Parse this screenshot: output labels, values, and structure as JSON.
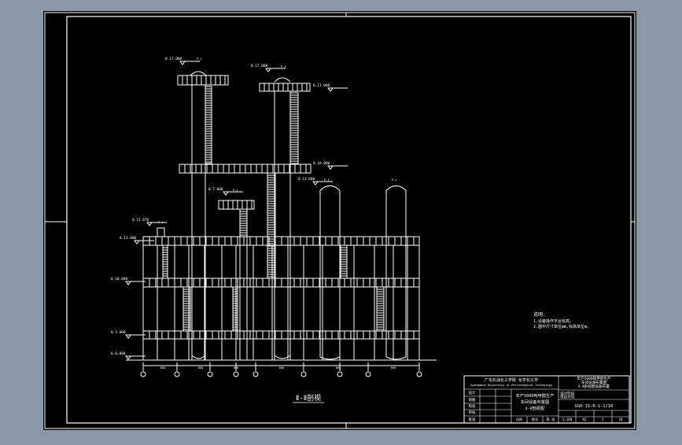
{
  "theme": {
    "background": "#8c98a7",
    "sheet": "#000000",
    "lines": "#ffffff"
  },
  "drawing": {
    "section_title": "Ⅱ-Ⅱ剖视",
    "notes_title": "说明:",
    "notes": [
      "1.设备操作平台标高。",
      "2.图中尺寸单位mm,标高单位m。"
    ],
    "elevations": {
      "left_top": "0.17.000",
      "mid_top": "0.17.000",
      "right_small": "0.11.000",
      "mid_level": "0.10.000",
      "small_top": "0.7.000",
      "vessel_a": "0.13.000",
      "vessel_b": "0.13.000",
      "left_stub": "0.13.070",
      "frame_top": "0.13.000",
      "frame_mid": "0.10.000",
      "frame_low": "0.3.000",
      "ground": "0.0.000"
    },
    "tag": "P-1",
    "dims": [
      "000",
      "000",
      "000",
      "000",
      "000",
      "000"
    ]
  },
  "title_block": {
    "company_cn": "广东石油化工学院  化学化工学",
    "company_en": "Guangdong University of Petrochemical Technology",
    "project_lines": [
      "年产5000吨甲醇生产",
      "车间设备布置图",
      "Ⅱ-Ⅱ剖视图设备布置"
    ],
    "main_title": [
      "年产5000吨甲醇生产",
      "车间设备布置图",
      "Ⅱ-Ⅱ剖视图"
    ],
    "drawing_no": "GSH-15-0-1-1/10",
    "row_labels": [
      "设计",
      "制图",
      "校核",
      "审核",
      "批准"
    ],
    "small_labels": [
      "比例",
      "图号",
      "第 张",
      "共 张"
    ],
    "side_labels": [
      "设计阶段",
      "项目代号"
    ],
    "bottom_cells": [
      "1:100",
      "A2",
      "1",
      "10"
    ]
  }
}
